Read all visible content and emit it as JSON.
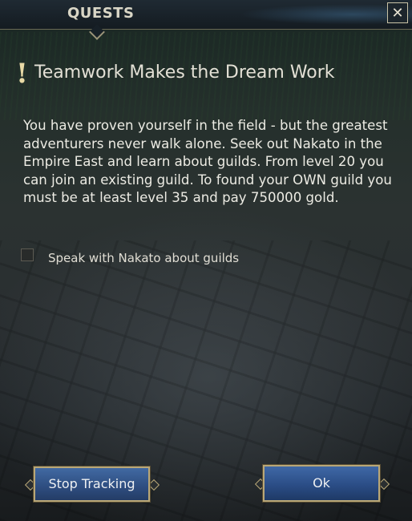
{
  "header": {
    "title": "QUESTS",
    "close_label": "✕"
  },
  "quest": {
    "title": "Teamwork Makes the Dream Work",
    "description": "You have proven yourself in the field - but the greatest adventurers never walk alone. Seek out Nakato in the Empire East and learn about guilds. From level 20 you can join an existing guild. To found your OWN guild you must be at least level 35 and pay 750000 gold.",
    "objectives": [
      {
        "label": "Speak with Nakato about guilds",
        "done": false
      }
    ]
  },
  "buttons": {
    "stop_tracking": "Stop Tracking",
    "ok": "Ok"
  },
  "colors": {
    "button_blue": "#2f4f82",
    "button_border": "#b9a777",
    "title_text": "#e3e0d5"
  },
  "icons": {
    "quest_marker": "exclamation-icon",
    "close": "close-icon",
    "checkbox": "checkbox-icon"
  }
}
